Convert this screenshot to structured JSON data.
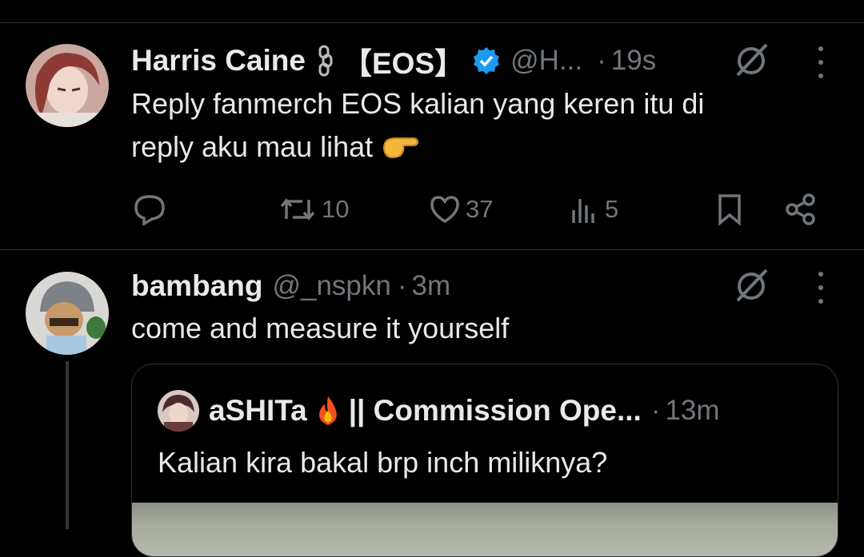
{
  "tweet": {
    "display_name": "Harris Caine",
    "name_emoji": "⛓",
    "name_tag": "【EOS】",
    "handle": "@H...",
    "separator": "·",
    "time": "19s",
    "text_line1": "Reply fanmerch EOS kalian yang keren itu di",
    "text_line2": "reply aku mau lihat",
    "text_emoji": "🫵",
    "actions": {
      "reposts": "10",
      "likes": "37",
      "views": "5"
    }
  },
  "reply": {
    "display_name": "bambang",
    "handle": "@_nspkn",
    "separator": "·",
    "time": "3m",
    "text": "come and measure it yourself",
    "quote": {
      "display_name": "aSHITa",
      "name_emoji": "🔥",
      "name_suffix": "|| Commission Ope...",
      "separator": "·",
      "time": "13m",
      "text": "Kalian kira bakal brp inch miliknya?"
    }
  },
  "colors": {
    "background": "#000000",
    "primary_text": "#e7e9ea",
    "secondary_text": "#71767b",
    "verified_badge": "#1d9bf0",
    "border": "#2f3336"
  },
  "icons": [
    "chain-icon",
    "verified-badge-icon",
    "grok-icon",
    "more-icon",
    "reply-icon",
    "repost-icon",
    "like-icon",
    "views-icon",
    "bookmark-icon",
    "share-icon",
    "fire-icon",
    "pointing-hand-emoji"
  ]
}
